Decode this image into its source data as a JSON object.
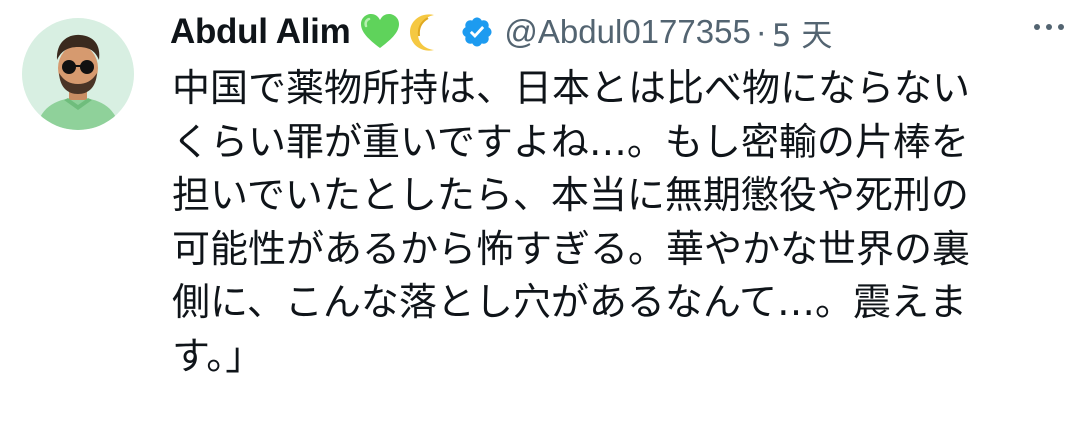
{
  "tweet": {
    "author_name": "Abdul Alim",
    "emojis": [
      "green-heart",
      "crescent-moon"
    ],
    "verified": true,
    "handle": "@Abdul0177355",
    "separator": "·",
    "time": "5 天",
    "text_lines": [
      "中国で薬物所持は、日本とは比べ物にならない",
      "くらい罪が重いですよね…。もし密輸の片棒を",
      "担いでいたとしたら、本当に無期懲役や死刑の",
      "可能性があるから怖すぎる。華やかな世界の裏",
      "側に、こんな落とし穴があるなんて…。震えま",
      "す。」"
    ]
  },
  "colors": {
    "text": "#0f1419",
    "secondary": "#536471",
    "verified_badge": "#1d9bf0",
    "heart": "#5fd35b"
  },
  "icons": {
    "verified": "verified-badge-icon",
    "more": "more-options-icon"
  }
}
